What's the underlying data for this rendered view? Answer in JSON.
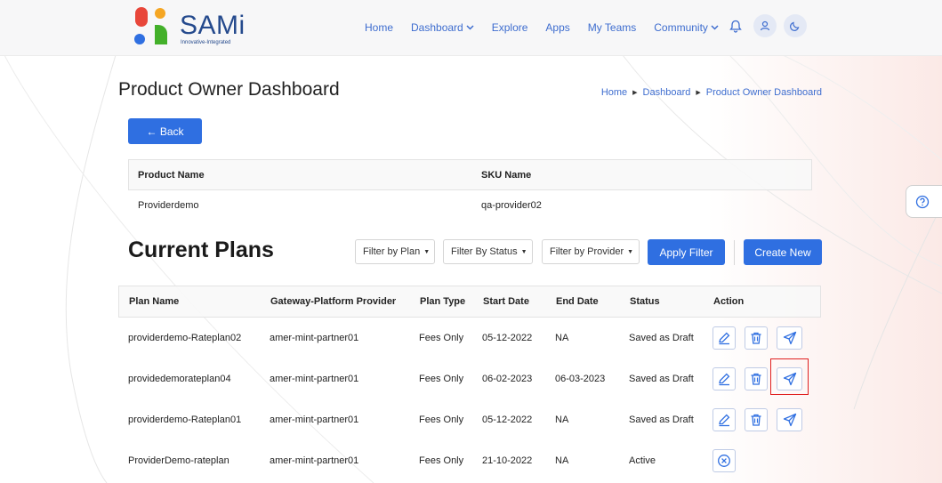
{
  "app": {
    "name": "SAMi",
    "tagline": "Innovative-Integrated",
    "colors": {
      "accent": "#2f6fe1",
      "brand": "#254a8d",
      "logo_orange": "#f5a623",
      "logo_red": "#e8463a",
      "logo_blue": "#2f6fe1",
      "logo_green": "#43b02a"
    }
  },
  "nav": {
    "home": "Home",
    "dashboard": "Dashboard",
    "explore": "Explore",
    "apps": "Apps",
    "my_teams": "My Teams",
    "community": "Community",
    "icons": [
      "bell-icon",
      "user-icon",
      "moon-icon"
    ]
  },
  "page": {
    "title": "Product Owner Dashboard",
    "breadcrumb": [
      "Home",
      "Dashboard",
      "Product Owner Dashboard"
    ],
    "back_label": "← Back"
  },
  "product": {
    "headers": {
      "name": "Product Name",
      "sku": "SKU Name"
    },
    "name": "Providerdemo",
    "sku": "qa-provider02"
  },
  "plans_section": {
    "title": "Current Plans",
    "filters": {
      "plan": "Filter by Plan",
      "status": "Filter By Status",
      "provider": "Filter by Provider"
    },
    "apply_label": "Apply Filter",
    "create_label": "Create New"
  },
  "plans_table": {
    "headers": [
      "Plan Name",
      "Gateway-Platform Provider",
      "Plan Type",
      "Start Date",
      "End Date",
      "Status",
      "Action"
    ],
    "rows": [
      {
        "plan_name": "providerdemo-Rateplan02",
        "provider": "amer-mint-partner01",
        "plan_type": "Fees Only",
        "start_date": "05-12-2022",
        "end_date": "NA",
        "status": "Saved as Draft",
        "actions": [
          "edit-icon",
          "trash-icon",
          "send-icon"
        ]
      },
      {
        "plan_name": "providedemorateplan04",
        "provider": "amer-mint-partner01",
        "plan_type": "Fees Only",
        "start_date": "06-02-2023",
        "end_date": "06-03-2023",
        "status": "Saved as Draft",
        "actions": [
          "edit-icon",
          "trash-icon",
          "send-icon"
        ]
      },
      {
        "plan_name": "providerdemo-Rateplan01",
        "provider": "amer-mint-partner01",
        "plan_type": "Fees Only",
        "start_date": "05-12-2022",
        "end_date": "NA",
        "status": "Saved as Draft",
        "actions": [
          "edit-icon",
          "trash-icon",
          "send-icon"
        ]
      },
      {
        "plan_name": "ProviderDemo-rateplan",
        "provider": "amer-mint-partner01",
        "plan_type": "Fees Only",
        "start_date": "21-10-2022",
        "end_date": "NA",
        "status": "Active",
        "actions": [
          "expire-icon"
        ]
      }
    ]
  },
  "help_icon": "help-icon"
}
